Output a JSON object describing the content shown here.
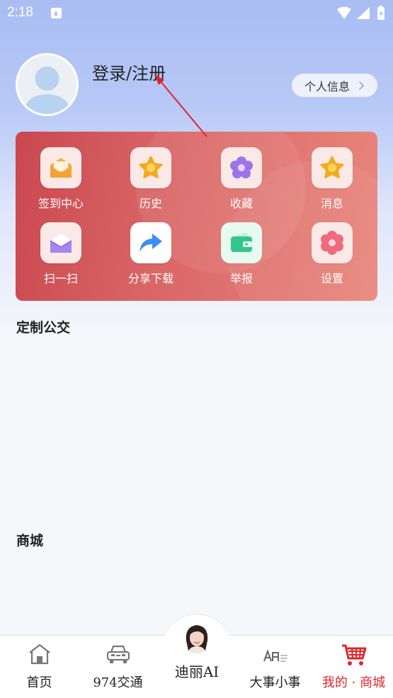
{
  "status_bar": {
    "time": "2:18"
  },
  "profile": {
    "login_text": "登录/注册",
    "info_button": "个人信息"
  },
  "grid": [
    {
      "label": "签到中心",
      "icon": "envelope-icon"
    },
    {
      "label": "历史",
      "icon": "star-icon"
    },
    {
      "label": "收藏",
      "icon": "flower-icon"
    },
    {
      "label": "消息",
      "icon": "star-icon"
    },
    {
      "label": "扫一扫",
      "icon": "envelope-open-icon"
    },
    {
      "label": "分享下载",
      "icon": "share-arrow-icon"
    },
    {
      "label": "举报",
      "icon": "wallet-icon"
    },
    {
      "label": "设置",
      "icon": "gear-flower-icon"
    }
  ],
  "sections": {
    "custom_bus": "定制公交",
    "mall": "商城"
  },
  "bottom_nav": {
    "items": [
      {
        "label": "首页",
        "icon": "home-icon"
      },
      {
        "label": "974交通",
        "icon": "car-icon"
      },
      {
        "label": "迪丽AI",
        "icon": "ai-avatar-icon"
      },
      {
        "label": "大事小事",
        "icon": "news-icon"
      },
      {
        "label": "我的 · 商城",
        "icon": "cart-icon"
      }
    ]
  },
  "colors": {
    "accent_red": "#e0242a",
    "card_start": "#c9484f",
    "card_end": "#e9877d"
  }
}
